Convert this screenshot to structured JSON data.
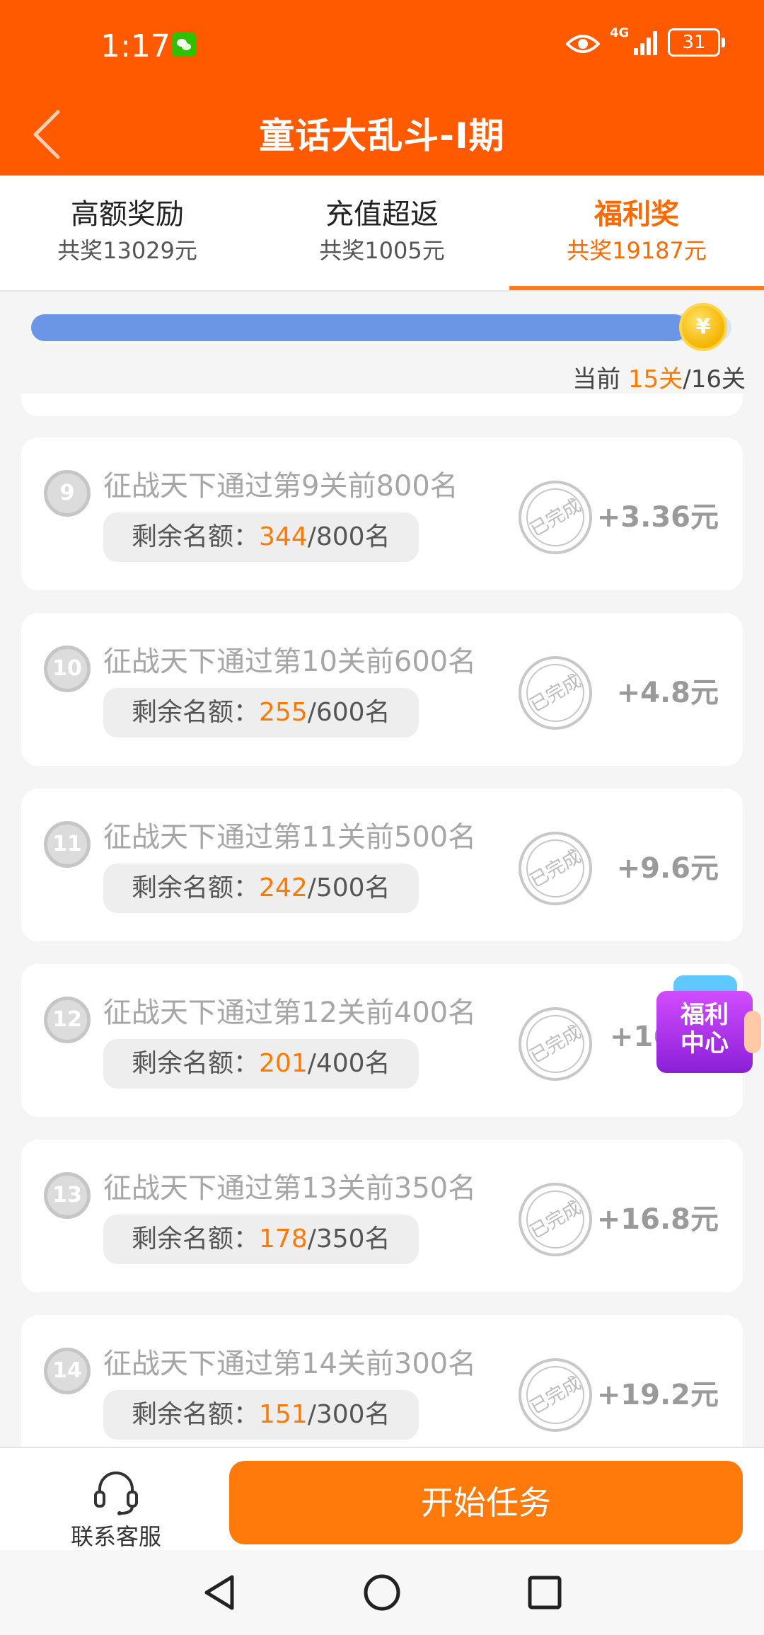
{
  "status_bar": {
    "time": "1:17",
    "network": "4G",
    "battery": "31"
  },
  "header": {
    "title": "童话大乱斗-I期"
  },
  "tabs": [
    {
      "label": "高额奖励",
      "sub": "共奖13029元"
    },
    {
      "label": "充值超返",
      "sub": "共奖1005元"
    },
    {
      "label": "福利奖",
      "sub": "共奖19187元"
    }
  ],
  "progress": {
    "current_prefix": "当前 ",
    "current": "15关",
    "total": "/16关",
    "fraction": 0.9375,
    "coin_symbol": "¥"
  },
  "tasks": [
    {
      "num": "9",
      "title": "征战天下通过第9关前800名",
      "quota_label": "剩余名额：",
      "remaining": "344",
      "total": "/800名",
      "amount": "+3.36元"
    },
    {
      "num": "10",
      "title": "征战天下通过第10关前600名",
      "quota_label": "剩余名额：",
      "remaining": "255",
      "total": "/600名",
      "amount": "+4.8元"
    },
    {
      "num": "11",
      "title": "征战天下通过第11关前500名",
      "quota_label": "剩余名额：",
      "remaining": "242",
      "total": "/500名",
      "amount": "+9.6元"
    },
    {
      "num": "12",
      "title": "征战天下通过第12关前400名",
      "quota_label": "剩余名额：",
      "remaining": "201",
      "total": "/400名",
      "amount": "+16"
    },
    {
      "num": "13",
      "title": "征战天下通过第13关前350名",
      "quota_label": "剩余名额：",
      "remaining": "178",
      "total": "/350名",
      "amount": "+16.8元"
    },
    {
      "num": "14",
      "title": "征战天下通过第14关前300名",
      "quota_label": "剩余名额：",
      "remaining": "151",
      "total": "/300名",
      "amount": "+19.2元"
    }
  ],
  "stamp_text": "已完成",
  "float_badge": {
    "line1": "福利",
    "line2": "中心"
  },
  "bottom": {
    "cs_label": "联系客服",
    "start_label": "开始任务"
  },
  "colors": {
    "header": "#ff5a00",
    "accent": "#ff7a00",
    "progress": "#6b96e6"
  }
}
